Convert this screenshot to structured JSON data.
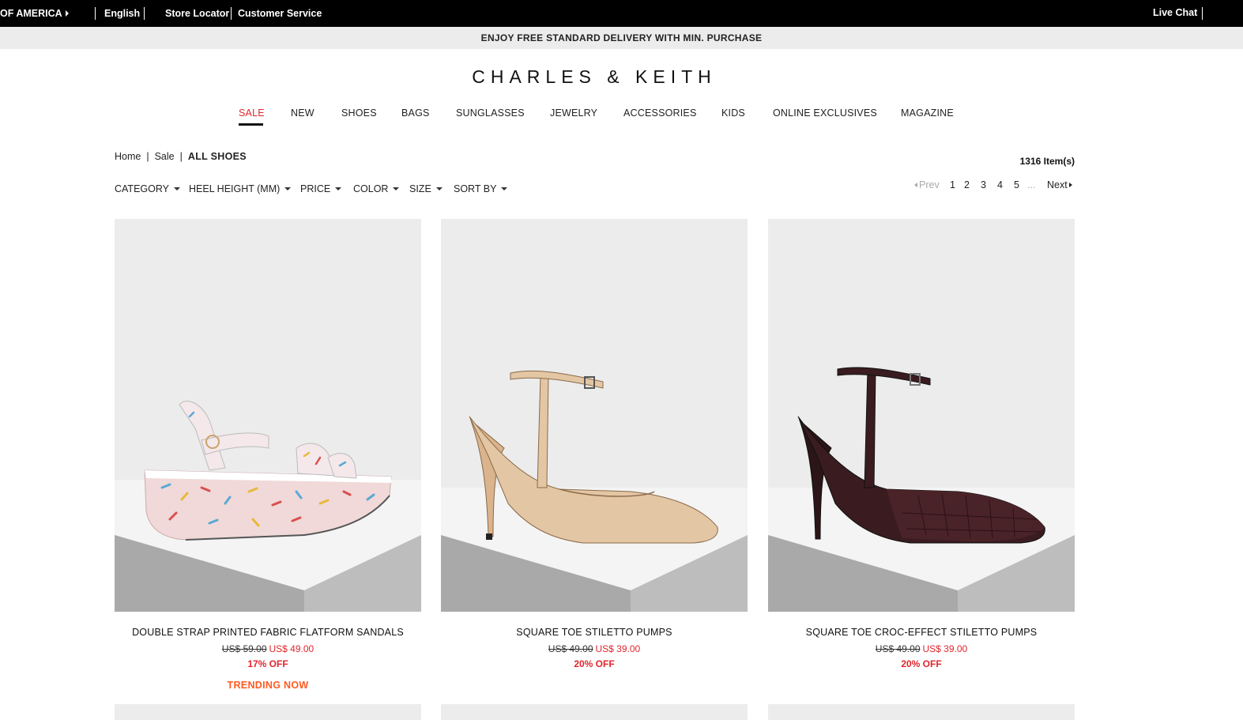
{
  "topbar": {
    "region": "OF AMERICA",
    "language": "English",
    "store_locator": "Store Locator",
    "customer_service": "Customer Service",
    "live_chat": "Live Chat"
  },
  "promo": "ENJOY FREE STANDARD DELIVERY WITH MIN. PURCHASE",
  "logo": "CHARLES & KEITH",
  "nav": [
    "SALE",
    "NEW",
    "SHOES",
    "BAGS",
    "SUNGLASSES",
    "JEWELRY",
    "ACCESSORIES",
    "KIDS",
    "ONLINE EXCLUSIVES",
    "MAGAZINE"
  ],
  "breadcrumb": {
    "home": "Home",
    "sale": "Sale",
    "current": "ALL SHOES",
    "separator": "|"
  },
  "item_count": "1316 Item(s)",
  "filters": [
    "CATEGORY",
    "HEEL HEIGHT (MM)",
    "PRICE",
    "COLOR",
    "SIZE",
    "SORT BY"
  ],
  "pagination": {
    "prev": "Prev",
    "pages": [
      "1",
      "2",
      "3",
      "4",
      "5"
    ],
    "ellipsis": "...",
    "next": "Next"
  },
  "products": [
    {
      "name": "DOUBLE STRAP PRINTED FABRIC FLATFORM SANDALS",
      "old_price": "US$ 59.00",
      "new_price": "US$ 49.00",
      "discount": "17% OFF",
      "tag": "TRENDING NOW"
    },
    {
      "name": "SQUARE TOE STILETTO PUMPS",
      "old_price": "US$ 49.00",
      "new_price": "US$ 39.00",
      "discount": "20% OFF",
      "tag": ""
    },
    {
      "name": "SQUARE TOE CROC-EFFECT STILETTO PUMPS",
      "old_price": "US$ 49.00",
      "new_price": "US$ 39.00",
      "discount": "20% OFF",
      "tag": ""
    }
  ],
  "colors": {
    "sale_red": "#e0262d",
    "trending_orange": "#ff5a1f",
    "topbar_bg": "#000000",
    "promo_bg": "#ececec"
  }
}
